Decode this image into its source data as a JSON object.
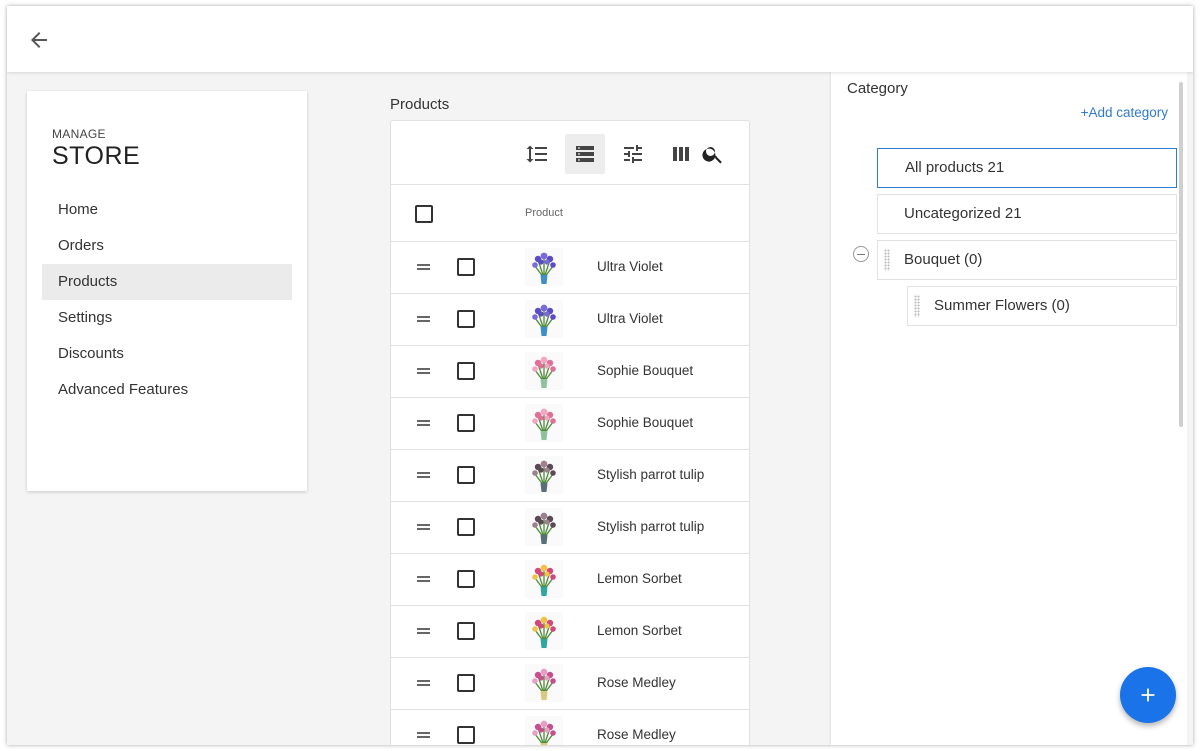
{
  "header": {
    "back_icon": "arrow-left-icon"
  },
  "nav": {
    "manage_label": "MANAGE",
    "store_label": "STORE",
    "items": [
      {
        "label": "Home",
        "active": false
      },
      {
        "label": "Orders",
        "active": false
      },
      {
        "label": "Products",
        "active": true
      },
      {
        "label": "Settings",
        "active": false
      },
      {
        "label": "Discounts",
        "active": false
      },
      {
        "label": "Advanced Features",
        "active": false
      }
    ]
  },
  "products": {
    "title": "Products",
    "column_product": "Product",
    "toolbar_icons": [
      "line-spacing-icon",
      "list-view-icon",
      "tune-icon",
      "columns-icon",
      "search-icon"
    ],
    "rows": [
      {
        "name": "Ultra Violet",
        "thumb": "violet"
      },
      {
        "name": "Ultra Violet",
        "thumb": "violet"
      },
      {
        "name": "Sophie Bouquet",
        "thumb": "pink"
      },
      {
        "name": "Sophie Bouquet",
        "thumb": "pink"
      },
      {
        "name": "Stylish parrot tulip",
        "thumb": "parrot"
      },
      {
        "name": "Stylish parrot tulip",
        "thumb": "parrot"
      },
      {
        "name": "Lemon Sorbet",
        "thumb": "lemon"
      },
      {
        "name": "Lemon Sorbet",
        "thumb": "lemon"
      },
      {
        "name": "Rose Medley",
        "thumb": "rose"
      },
      {
        "name": "Rose Medley",
        "thumb": "rose"
      }
    ]
  },
  "category": {
    "title": "Category",
    "add_label": "+Add category",
    "items": [
      {
        "label": "All products 21"
      },
      {
        "label": "Uncategorized 21"
      },
      {
        "label": "Bouquet (0)"
      },
      {
        "label": "Summer Flowers (0)"
      }
    ]
  },
  "colors": {
    "accent": "#2f7ad1",
    "fab": "#1a73e8",
    "active_nav": "#ebebeb"
  },
  "fab_icon": "plus-icon"
}
